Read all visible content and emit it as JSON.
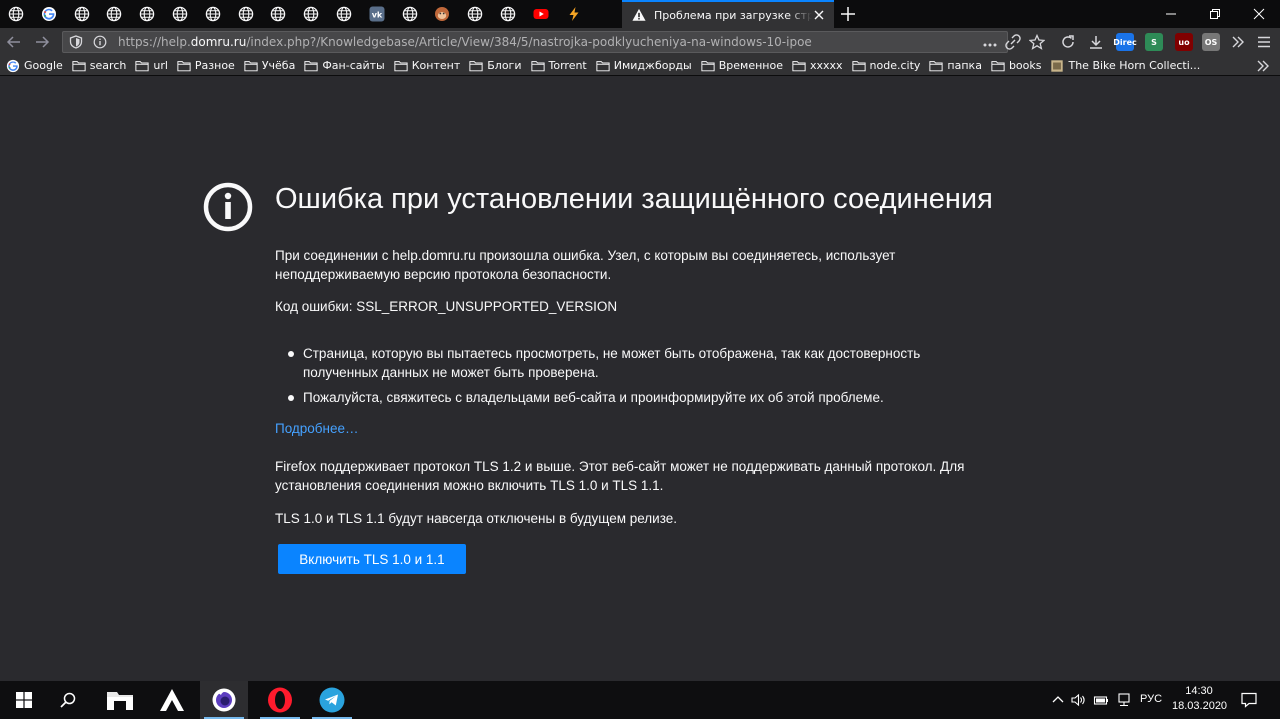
{
  "browser": {
    "pinned_tabs": [
      {
        "icon": "globe-icon"
      },
      {
        "icon": "google-icon"
      },
      {
        "icon": "globe-icon"
      },
      {
        "icon": "globe-icon"
      },
      {
        "icon": "globe-icon"
      },
      {
        "icon": "globe-icon"
      },
      {
        "icon": "globe-icon"
      },
      {
        "icon": "globe-icon"
      },
      {
        "icon": "globe-icon"
      },
      {
        "icon": "globe-icon"
      },
      {
        "icon": "globe-icon"
      },
      {
        "icon": "vk-icon"
      },
      {
        "icon": "globe-icon"
      },
      {
        "icon": "monkey-icon"
      },
      {
        "icon": "globe-icon"
      },
      {
        "icon": "globe-icon"
      },
      {
        "icon": "youtube-icon"
      },
      {
        "icon": "lightning-icon"
      }
    ],
    "active_tab": {
      "title": "Проблема при загрузке страницы",
      "icon": "warning-icon"
    },
    "url": {
      "prefix": "https://help.",
      "host": "domru.ru",
      "path": "/index.php?/Knowledgebase/Article/View/384/5/nastrojka-podklyucheniya-na-windows-10-ipoe"
    },
    "extensions": [
      {
        "name": "direct-extension",
        "label": "Direc",
        "color": "#1a73e8"
      },
      {
        "name": "s-extension",
        "label": "S",
        "color": "#2e8b57"
      },
      {
        "name": "ublock-extension",
        "label": "uo",
        "color": "#800000"
      },
      {
        "name": "os-extension",
        "label": "OS",
        "color": "#777777"
      }
    ],
    "bookmarks": [
      {
        "label": "Google",
        "icon": "google-icon"
      },
      {
        "label": "search",
        "icon": "folder-icon"
      },
      {
        "label": "url",
        "icon": "folder-icon"
      },
      {
        "label": "Разное",
        "icon": "folder-icon"
      },
      {
        "label": "Учёба",
        "icon": "folder-icon"
      },
      {
        "label": "Фан-сайты",
        "icon": "folder-icon"
      },
      {
        "label": "Контент",
        "icon": "folder-icon"
      },
      {
        "label": "Блоги",
        "icon": "folder-icon"
      },
      {
        "label": "Torrent",
        "icon": "folder-icon"
      },
      {
        "label": "Имиджборды",
        "icon": "folder-icon"
      },
      {
        "label": "Временное",
        "icon": "folder-icon"
      },
      {
        "label": "xxxxx",
        "icon": "folder-icon"
      },
      {
        "label": "node.city",
        "icon": "folder-icon"
      },
      {
        "label": "папка",
        "icon": "folder-icon"
      },
      {
        "label": "books",
        "icon": "folder-icon"
      },
      {
        "label": "The Bike Horn Collecti...",
        "icon": "page-icon"
      }
    ]
  },
  "error": {
    "title": "Ошибка при установлении защищённого соединения",
    "intro": "При соединении с help.domru.ru произошла ошибка. Узел, с которым вы соединяетесь, использует неподдерживаемую версию протокола безопасности.",
    "code": "Код ошибки: SSL_ERROR_UNSUPPORTED_VERSION",
    "bullets": [
      "Страница, которую вы пытаетесь просмотреть, не может быть отображена, так как достоверность полученных данных не может быть проверена.",
      "Пожалуйста, свяжитесь с владельцами веб-сайта и проинформируйте их об этой проблеме."
    ],
    "learn_more": "Подробнее…",
    "tls_note": "Firefox поддерживает протокол TLS 1.2 и выше. Этот веб-сайт может не поддерживать данный протокол. Для установления соединения можно включить TLS 1.0 и TLS 1.1.",
    "tls_future": "TLS 1.0 и TLS 1.1 будут навсегда отключены в будущем релизе.",
    "enable_button": "Включить TLS 1.0 и 1.1"
  },
  "taskbar": {
    "apps": [
      "start-icon",
      "search-icon",
      "file-explorer-icon",
      "arch-icon",
      "firefox-icon",
      "opera-icon",
      "telegram-icon"
    ],
    "lang": "РУС",
    "time": "14:30",
    "date": "18.03.2020"
  }
}
